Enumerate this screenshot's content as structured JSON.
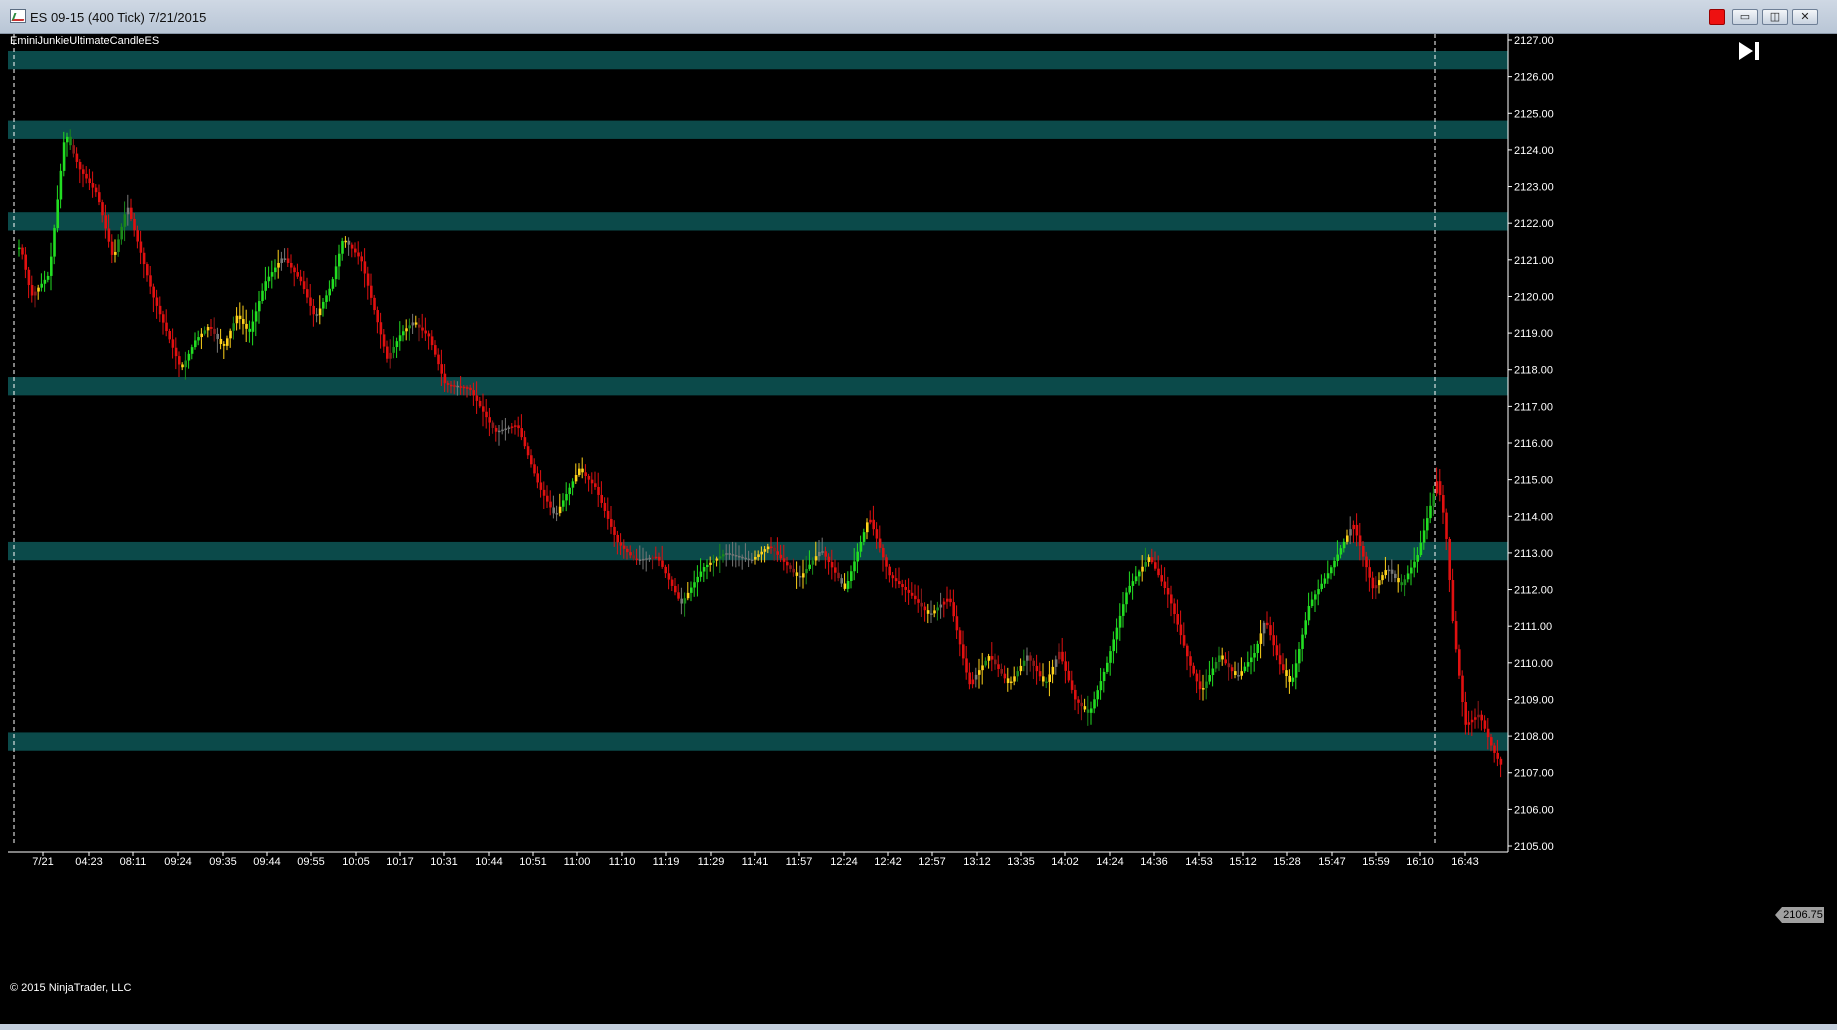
{
  "window": {
    "title": "ES 09-15 (400 Tick)  7/21/2015",
    "buttons": {
      "record": "",
      "minimize": "▭",
      "maximize": "◫",
      "close": "✕"
    },
    "icon": "chart-window-icon"
  },
  "chart": {
    "indicator_label": "EminiJunkieUltimateCandleES",
    "copyright": "© 2015 NinjaTrader, LLC",
    "current_price": "2106.75",
    "go_to_end_icon": "skip-to-end-icon",
    "price_axis": [
      "2127.00",
      "2126.00",
      "2125.00",
      "2124.00",
      "2123.00",
      "2122.00",
      "2121.00",
      "2120.00",
      "2119.00",
      "2118.00",
      "2117.00",
      "2116.00",
      "2115.00",
      "2114.00",
      "2113.00",
      "2112.00",
      "2111.00",
      "2110.00",
      "2109.00",
      "2108.00",
      "2107.00",
      "2106.00",
      "2105.00"
    ],
    "time_axis": [
      "7/21",
      "04:23",
      "08:11",
      "09:24",
      "09:35",
      "09:44",
      "09:55",
      "10:05",
      "10:17",
      "10:31",
      "10:44",
      "10:51",
      "11:00",
      "11:10",
      "11:19",
      "11:29",
      "11:41",
      "11:57",
      "12:24",
      "12:42",
      "12:57",
      "13:12",
      "13:35",
      "14:02",
      "14:24",
      "14:36",
      "14:53",
      "15:12",
      "15:28",
      "15:47",
      "15:59",
      "16:10",
      "16:43"
    ],
    "zones": [
      {
        "low": 2126.2,
        "high": 2126.7
      },
      {
        "low": 2124.3,
        "high": 2124.8
      },
      {
        "low": 2121.8,
        "high": 2122.3
      },
      {
        "low": 2117.3,
        "high": 2117.8
      },
      {
        "low": 2112.8,
        "high": 2113.3
      },
      {
        "low": 2107.6,
        "high": 2108.1
      }
    ],
    "session_breaks": [
      "7/21",
      "16:10"
    ],
    "colors": {
      "zone": "#0b4a4a",
      "bull_strong": "#22dd22",
      "bull": "#1a8a1a",
      "bear": "#e01010",
      "bear_weak": "#8a1a1a",
      "neutral": "#ffd21a",
      "flat": "#777777",
      "axis_text": "#ffffff"
    },
    "chart_data": {
      "type": "candlestick",
      "ylim": [
        2105.0,
        2127.0
      ],
      "price_path": [
        [
          0,
          2121.5
        ],
        [
          12,
          2121.3
        ],
        [
          22,
          2120.0
        ],
        [
          40,
          2120.6
        ],
        [
          56,
          2124.5
        ],
        [
          70,
          2123.5
        ],
        [
          88,
          2122.8
        ],
        [
          104,
          2121.0
        ],
        [
          118,
          2122.5
        ],
        [
          144,
          2120.0
        ],
        [
          172,
          2118.0
        ],
        [
          186,
          2118.8
        ],
        [
          200,
          2119.2
        ],
        [
          214,
          2118.6
        ],
        [
          228,
          2119.5
        ],
        [
          240,
          2119.0
        ],
        [
          256,
          2120.4
        ],
        [
          274,
          2121.1
        ],
        [
          292,
          2120.4
        ],
        [
          306,
          2119.4
        ],
        [
          322,
          2120.3
        ],
        [
          334,
          2121.6
        ],
        [
          352,
          2121.0
        ],
        [
          378,
          2118.3
        ],
        [
          392,
          2119.0
        ],
        [
          404,
          2119.3
        ],
        [
          420,
          2118.9
        ],
        [
          436,
          2117.6
        ],
        [
          460,
          2117.5
        ],
        [
          486,
          2116.3
        ],
        [
          508,
          2116.5
        ],
        [
          530,
          2114.8
        ],
        [
          546,
          2114.0
        ],
        [
          570,
          2115.3
        ],
        [
          586,
          2114.8
        ],
        [
          608,
          2113.3
        ],
        [
          626,
          2112.8
        ],
        [
          648,
          2112.9
        ],
        [
          672,
          2111.6
        ],
        [
          694,
          2112.6
        ],
        [
          716,
          2113.0
        ],
        [
          742,
          2112.8
        ],
        [
          760,
          2113.2
        ],
        [
          790,
          2112.3
        ],
        [
          812,
          2113.1
        ],
        [
          836,
          2112.0
        ],
        [
          860,
          2114.0
        ],
        [
          880,
          2112.4
        ],
        [
          904,
          2111.8
        ],
        [
          920,
          2111.3
        ],
        [
          940,
          2111.8
        ],
        [
          960,
          2109.4
        ],
        [
          980,
          2110.2
        ],
        [
          1000,
          2109.4
        ],
        [
          1018,
          2110.2
        ],
        [
          1036,
          2109.4
        ],
        [
          1050,
          2110.3
        ],
        [
          1066,
          2109.0
        ],
        [
          1080,
          2108.6
        ],
        [
          1098,
          2110.0
        ],
        [
          1118,
          2112.0
        ],
        [
          1140,
          2112.9
        ],
        [
          1160,
          2111.8
        ],
        [
          1180,
          2110.0
        ],
        [
          1192,
          2109.2
        ],
        [
          1210,
          2110.2
        ],
        [
          1228,
          2109.6
        ],
        [
          1246,
          2110.3
        ],
        [
          1256,
          2111.2
        ],
        [
          1270,
          2110.0
        ],
        [
          1282,
          2109.4
        ],
        [
          1300,
          2111.6
        ],
        [
          1320,
          2112.5
        ],
        [
          1344,
          2113.8
        ],
        [
          1364,
          2112.0
        ],
        [
          1378,
          2112.6
        ],
        [
          1392,
          2112.1
        ],
        [
          1408,
          2112.9
        ],
        [
          1428,
          2115.0
        ],
        [
          1436,
          2113.8
        ],
        [
          1444,
          2111.0
        ],
        [
          1456,
          2108.3
        ],
        [
          1470,
          2108.6
        ],
        [
          1484,
          2107.6
        ],
        [
          1496,
          2107.0
        ]
      ]
    }
  }
}
